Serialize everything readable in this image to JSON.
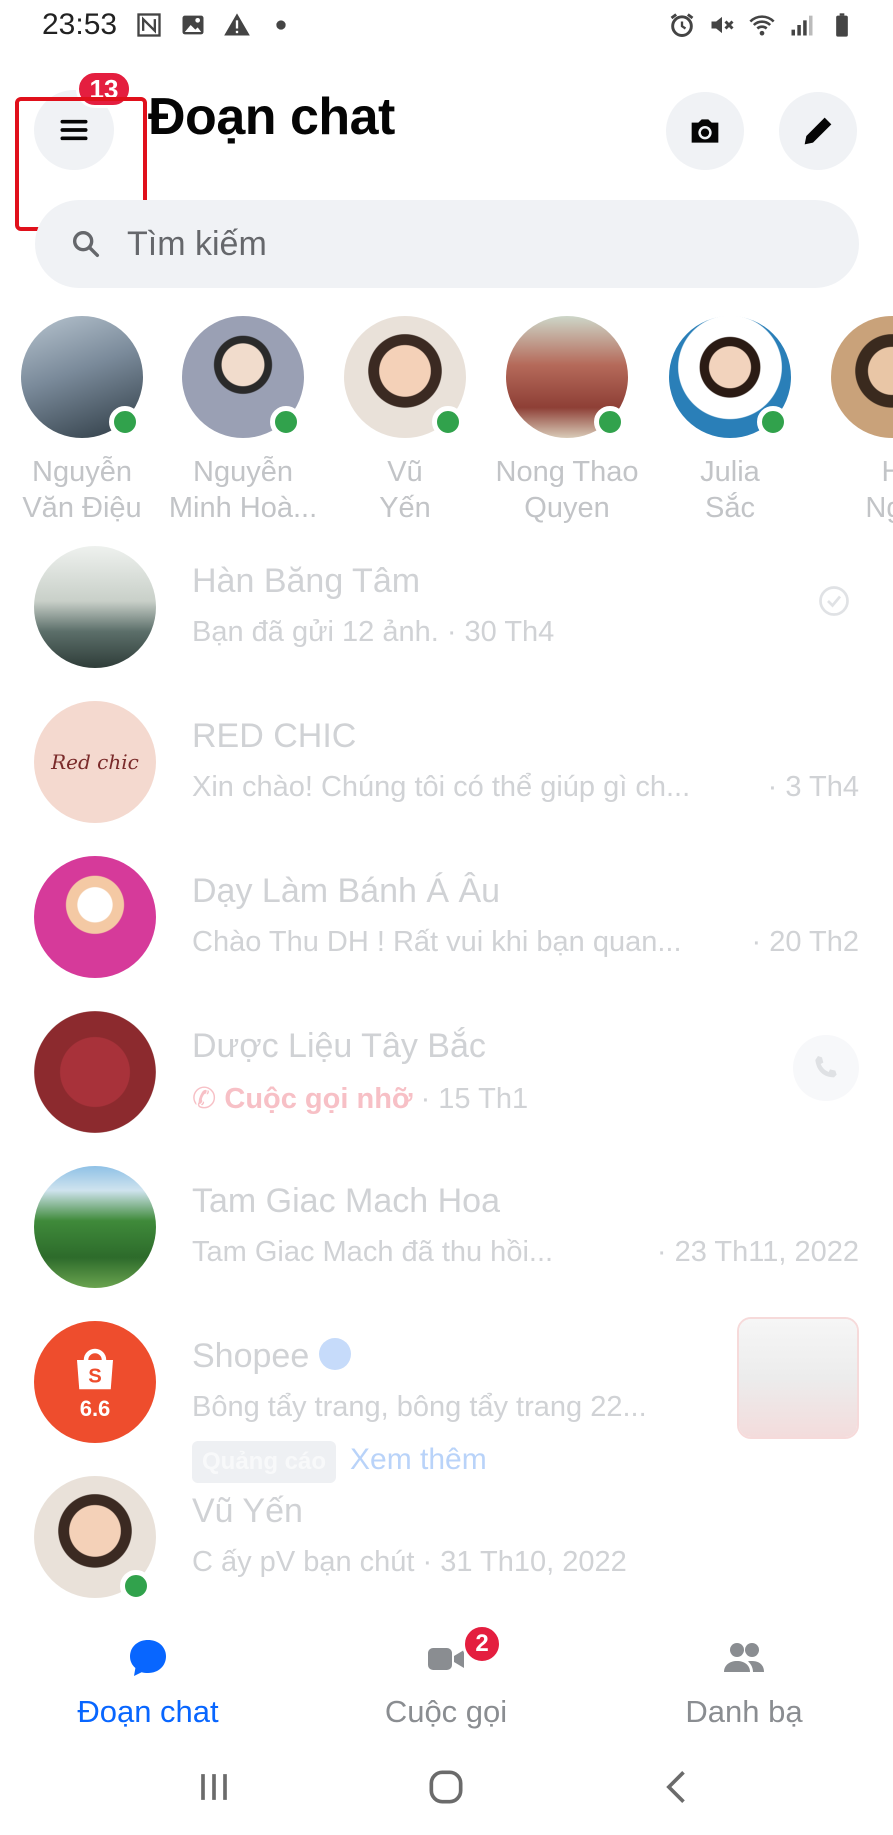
{
  "status_bar": {
    "time": "23:53",
    "left_icons": [
      "n-icon",
      "image-icon",
      "warning-icon",
      "dot-icon"
    ],
    "right_icons": [
      "alarm-icon",
      "mute-icon",
      "wifi-icon",
      "signal-icon",
      "battery-icon"
    ]
  },
  "header": {
    "title": "Đoạn chat",
    "menu_badge": "13"
  },
  "search": {
    "placeholder": "Tìm kiếm"
  },
  "stories": [
    {
      "name_line1": "Nguyễn",
      "name_line2": "Văn Điệu",
      "online": true,
      "color": "#7a8a9a"
    },
    {
      "name_line1": "Nguyễn",
      "name_line2": "Minh Hoà...",
      "online": true,
      "color": "#9aa0b4"
    },
    {
      "name_line1": "Vũ",
      "name_line2": "Yến",
      "online": true,
      "color": "#e8c4a8"
    },
    {
      "name_line1": "Nong Thao",
      "name_line2": "Quyen",
      "online": true,
      "color": "#b56a5a"
    },
    {
      "name_line1": "Julia",
      "name_line2": "Sắc",
      "online": true,
      "color": "#2a7fb8"
    },
    {
      "name_line1": "H",
      "name_line2": "Ngu",
      "online": false,
      "color": "#c9a27a"
    }
  ],
  "chats": [
    {
      "name": "Hàn Băng Tâm",
      "snippet": "Bạn đã gửi 12 ảnh. · 30 Th4",
      "time": "",
      "avatar_color": "#5c6f6a"
    },
    {
      "name": "RED CHIC",
      "snippet": "Xin chào! Chúng tôi có thể giúp gì ch...",
      "time": "· 3 Th4",
      "avatar_color": "#f4d9cf",
      "logo": "Red chic"
    },
    {
      "name": "Dạy Làm Bánh Á Âu",
      "snippet": "Chào Thu DH ! Rất vui khi bạn quan...",
      "time": "· 20 Th2",
      "avatar_color": "#d63a9a"
    },
    {
      "name": "Dược Liệu Tây Bắc",
      "snippet": "Cuộc gọi nhỡ",
      "time_inline": "· 15 Th1",
      "avatar_color": "#8c2a2e"
    },
    {
      "name": "Tam Giac Mach Hoa",
      "snippet": "Tam Giac Mach đã thu hồi...",
      "time": "· 23 Th11, 2022",
      "avatar_color": "#3f8a3a"
    },
    {
      "name": "Shopee",
      "snippet": "Bông tẩy trang, bông tẩy trang 22...",
      "ad_label": "Quảng cáo",
      "ad_more": "Xem thêm",
      "avatar_color": "#ee4d2d",
      "avatar_text": "6.6"
    },
    {
      "name": "Vũ Yến",
      "snippet": "C ấy pV bạn chút · 31 Th10, 2022",
      "time": "",
      "avatar_color": "#e8c4a8",
      "online": true
    }
  ],
  "bottom_nav": {
    "chats_label": "Đoạn chat",
    "calls_label": "Cuộc gọi",
    "calls_badge": "2",
    "contacts_label": "Danh bạ"
  },
  "colors": {
    "accent": "#0866ff",
    "badge": "#e41e3f",
    "online": "#31a24c",
    "highlight": "#e0101b"
  }
}
